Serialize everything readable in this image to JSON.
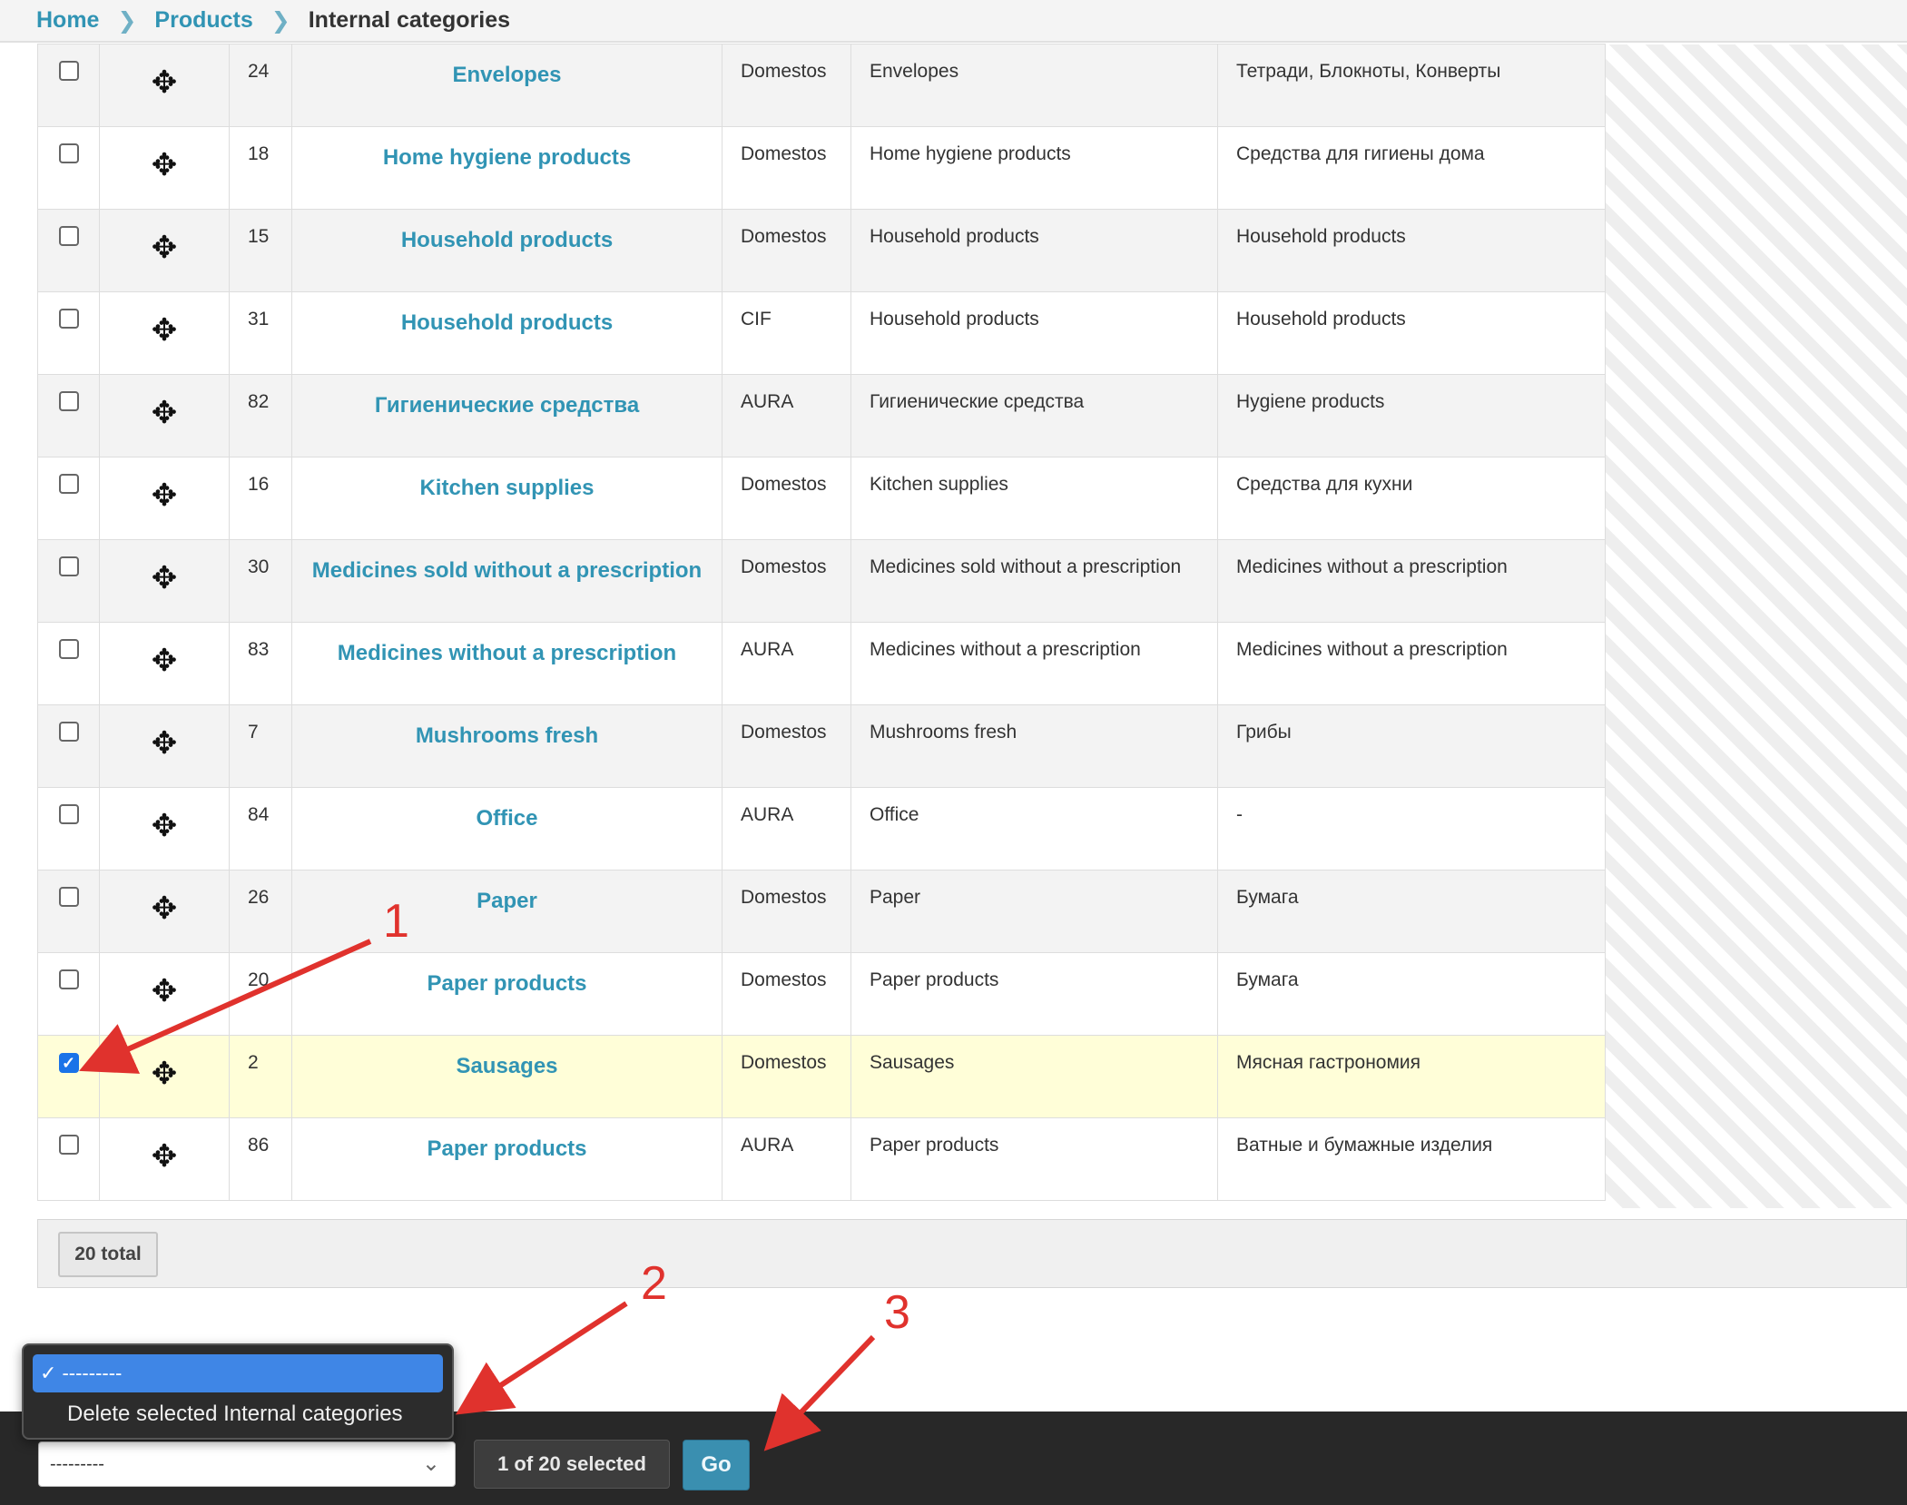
{
  "breadcrumbs": {
    "home": "Home",
    "products": "Products",
    "current": "Internal categories",
    "separator": ">"
  },
  "rows": [
    {
      "id": "24",
      "title": "Envelopes",
      "brand": "Domestos",
      "name": "Envelopes",
      "internal": "Тетради, Блокноты, Конверты",
      "checked": false
    },
    {
      "id": "18",
      "title": "Home hygiene products",
      "brand": "Domestos",
      "name": "Home hygiene products",
      "internal": "Средства для гигиены дома",
      "checked": false
    },
    {
      "id": "15",
      "title": "Household products",
      "brand": "Domestos",
      "name": "Household products",
      "internal": "Household products",
      "checked": false
    },
    {
      "id": "31",
      "title": "Household products",
      "brand": "CIF",
      "name": "Household products",
      "internal": "Household products",
      "checked": false
    },
    {
      "id": "82",
      "title": "Гигиенические средства",
      "brand": "AURA",
      "name": "Гигиенические средства",
      "internal": "Hygiene products",
      "checked": false
    },
    {
      "id": "16",
      "title": "Kitchen supplies",
      "brand": "Domestos",
      "name": "Kitchen supplies",
      "internal": "Средства для кухни",
      "checked": false
    },
    {
      "id": "30",
      "title": "Medicines sold without a prescription",
      "brand": "Domestos",
      "name": "Medicines sold without a prescription",
      "internal": "Medicines without a prescription",
      "checked": false
    },
    {
      "id": "83",
      "title": "Medicines without a prescription",
      "brand": "AURA",
      "name": "Medicines without a prescription",
      "internal": "Medicines without a prescription",
      "checked": false
    },
    {
      "id": "7",
      "title": "Mushrooms fresh",
      "brand": "Domestos",
      "name": "Mushrooms fresh",
      "internal": "Грибы",
      "checked": false
    },
    {
      "id": "84",
      "title": "Office",
      "brand": "AURA",
      "name": "Office",
      "internal": "-",
      "checked": false
    },
    {
      "id": "26",
      "title": "Paper",
      "brand": "Domestos",
      "name": "Paper",
      "internal": "Бумага",
      "checked": false
    },
    {
      "id": "20",
      "title": "Paper products",
      "brand": "Domestos",
      "name": "Paper products",
      "internal": "Бумага",
      "checked": false
    },
    {
      "id": "2",
      "title": "Sausages",
      "brand": "Domestos",
      "name": "Sausages",
      "internal": "Мясная гастрономия",
      "checked": true
    },
    {
      "id": "86",
      "title": "Paper products",
      "brand": "AURA",
      "name": "Paper products",
      "internal": "Ватные и бумажные изделия",
      "checked": false
    }
  ],
  "paginator": {
    "total": "20 total"
  },
  "actions": {
    "select_value": "---------",
    "options": [
      "---------",
      "Delete selected Internal categories"
    ],
    "selected_count": "1 of 20 selected",
    "go_label": "Go"
  },
  "annotations": {
    "n1": "1",
    "n2": "2",
    "n3": "3",
    "color": "#e0322d"
  },
  "icons": {
    "drag": "move-arrows-icon",
    "check": "checkmark-icon",
    "chevron": "chevron-down-icon"
  },
  "colors": {
    "link": "#3194b4",
    "selected_row": "#fffed8",
    "go_button": "#3a8fb0",
    "dropdown_highlight": "#3f86e6"
  }
}
